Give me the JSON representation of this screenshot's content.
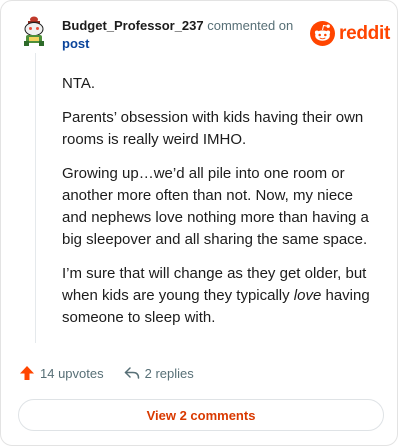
{
  "comment": {
    "author": "Budget_Professor_237",
    "action_text": "commented on",
    "target_link": "post",
    "paragraphs": {
      "p1": "NTA.",
      "p2": "Parents’ obsession with kids having their own rooms is really weird IMHO.",
      "p3": "Growing up…we’d all pile into one room or another more often than not. Now, my niece and nephews love nothing more than having a big sleepover and all sharing the same space.",
      "p4_before": "I’m sure that will change as they get older, but when kids are young they typically ",
      "p4_emphasis": "love",
      "p4_after": " having someone to sleep with."
    },
    "upvotes_label": "14 upvotes",
    "replies_label": "2 replies",
    "view_comments_label": "View 2 comments"
  },
  "brand": {
    "wordmark": "reddit",
    "accent_color": "#ff4500",
    "link_color": "#0a449b",
    "button_text_color": "#d93900"
  },
  "icons": {
    "avatar": "snoo-avatar-icon",
    "logo": "reddit-snoo-icon",
    "upvote": "upvote-arrow-icon",
    "reply": "reply-arrow-icon"
  }
}
